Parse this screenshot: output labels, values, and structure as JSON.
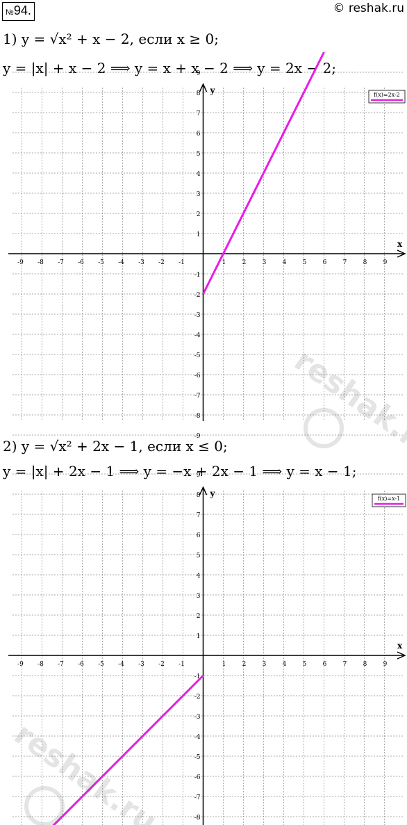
{
  "header": {
    "problem_prefix": "№",
    "problem_number": "94.",
    "copyright": "© reshak.ru"
  },
  "part1": {
    "line1": "1) y = √x² + x − 2, если x ≥ 0;",
    "line2": "y = |x| + x − 2 ⟹ y = x + x − 2 ⟹ y = 2x − 2;"
  },
  "part2": {
    "line1": "2) y = √x² + 2x − 1, если x ≤ 0;",
    "line2": "y = |x| + 2x − 1 ⟹ y = −x + 2x − 1 ⟹ y = x − 1;"
  },
  "watermark": "reshak.ru",
  "colors": {
    "line": "#e51ee5",
    "grid": "#8c8c8c",
    "axis": "#000000"
  },
  "chart_data": [
    {
      "type": "line",
      "xlabel": "x",
      "ylabel": "y",
      "xlim": [
        -9,
        9
      ],
      "ylim": [
        -9,
        9
      ],
      "x_ticks": [
        "-9",
        "-8",
        "-7",
        "-6",
        "-5",
        "-4",
        "-3",
        "-2",
        "-1",
        "1",
        "2",
        "3",
        "4",
        "5",
        "6",
        "7",
        "8",
        "9"
      ],
      "y_ticks": [
        "9",
        "8",
        "7",
        "6",
        "5",
        "4",
        "3",
        "2",
        "1",
        "-1",
        "-2",
        "-3",
        "-4",
        "-5",
        "-6",
        "-7",
        "-8",
        "-9"
      ],
      "grid": true,
      "legend_position": "top-right",
      "series": [
        {
          "name": "f(x)=2x-2",
          "x": [
            0,
            6
          ],
          "y": [
            -2,
            10
          ]
        }
      ]
    },
    {
      "type": "line",
      "xlabel": "x",
      "ylabel": "y",
      "xlim": [
        -9,
        9
      ],
      "ylim": [
        -9,
        9
      ],
      "x_ticks": [
        "-9",
        "-8",
        "-7",
        "-6",
        "-5",
        "-4",
        "-3",
        "-2",
        "-1",
        "1",
        "2",
        "3",
        "4",
        "5",
        "6",
        "7",
        "8",
        "9"
      ],
      "y_ticks": [
        "9",
        "8",
        "7",
        "6",
        "5",
        "4",
        "3",
        "2",
        "1",
        "-1",
        "-2",
        "-3",
        "-4",
        "-5",
        "-6",
        "-7",
        "-8",
        "-9"
      ],
      "grid": true,
      "legend_position": "top-right",
      "series": [
        {
          "name": "f(x)=x-1",
          "x": [
            -9,
            0
          ],
          "y": [
            -10,
            -1
          ]
        }
      ]
    }
  ]
}
